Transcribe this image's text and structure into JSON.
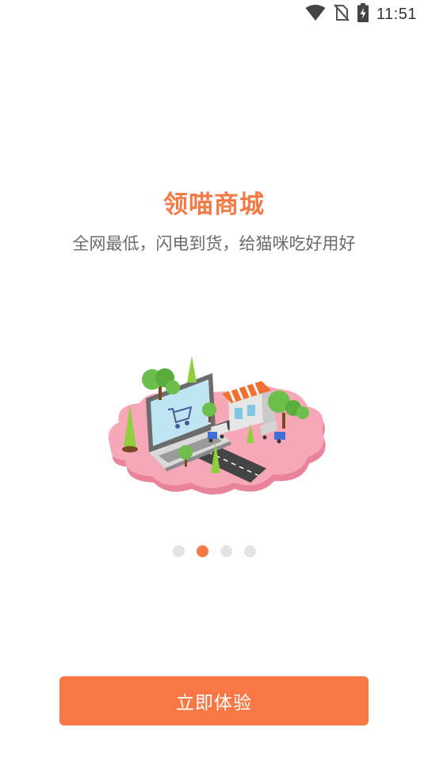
{
  "status_bar": {
    "time": "11:51",
    "icons": [
      "wifi-icon",
      "no-sim-icon",
      "battery-charging-icon"
    ]
  },
  "intro": {
    "title": "领喵商城",
    "subtitle": "全网最低，闪电到货，给猫咪吃好用好"
  },
  "pager": {
    "total": 4,
    "active_index": 1
  },
  "cta": {
    "label": "立即体验"
  },
  "colors": {
    "accent": "#f47a45",
    "button": "#f87745",
    "dot_inactive": "#e3e3e3",
    "island": "#f7a8b8"
  }
}
